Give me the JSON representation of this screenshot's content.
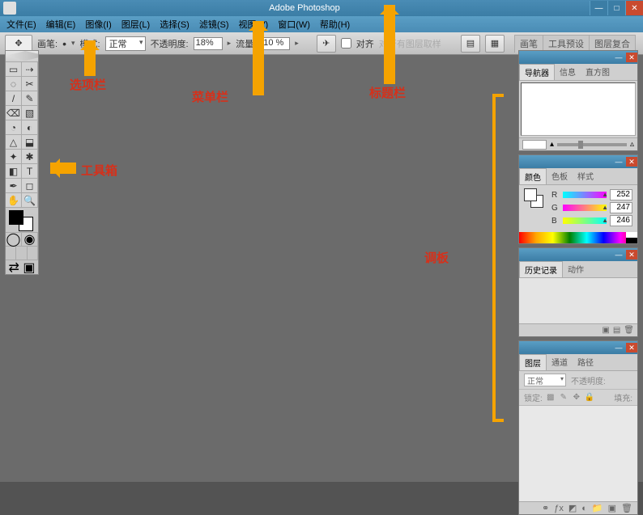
{
  "app_title": "Adobe Photoshop",
  "menus": {
    "file": "文件(E)",
    "edit": "编辑(E)",
    "image": "图像(I)",
    "layer": "图层(L)",
    "select": "选择(S)",
    "filter": "滤镜(S)",
    "view": "视图(V)",
    "window": "窗口(W)",
    "help": "帮助(H)"
  },
  "options": {
    "brush_label": "画笔:",
    "mode_label": "模式:",
    "mode_value": "正常",
    "opacity_label": "不透明度:",
    "opacity_value": "18%",
    "flow_label": "流量:",
    "flow_value": "10 %",
    "align_label": "对齐",
    "align_hint": "对所有图层取样",
    "presets": {
      "brush": "画笔",
      "tool": "工具预设",
      "comp": "图层复合"
    }
  },
  "panels": {
    "navigator": {
      "tab1": "导航器",
      "tab2": "信息",
      "tab3": "直方图"
    },
    "color": {
      "tab1": "颜色",
      "tab2": "色板",
      "tab3": "样式",
      "r_label": "R",
      "g_label": "G",
      "b_label": "B",
      "r": "252",
      "g": "247",
      "b": "246"
    },
    "history": {
      "tab1": "历史记录",
      "tab2": "动作"
    },
    "layers": {
      "tab1": "图层",
      "tab2": "通道",
      "tab3": "路径",
      "blend": "正常",
      "opacity_label": "不透明度:",
      "lock_label": "锁定:",
      "fill_label": "填充:"
    }
  },
  "annotations": {
    "optionsbar": "选项栏",
    "menubar": "菜单栏",
    "titlebar": "标题栏",
    "toolbox": "工具箱",
    "panels": "调板"
  },
  "tool_icons": [
    "▭",
    "⇢",
    "◌",
    "✂",
    "/",
    "✎",
    "⌫",
    "▧",
    "◔",
    "◐",
    "△",
    "⬓",
    "✦",
    "✱",
    "◧",
    "T",
    "✒",
    "◻",
    "✋",
    "🔍"
  ]
}
